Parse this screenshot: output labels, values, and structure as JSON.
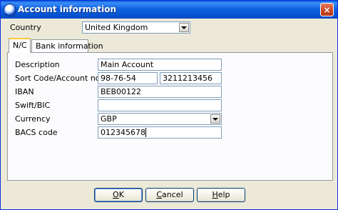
{
  "window": {
    "title": "Account information",
    "close_label": "×"
  },
  "country": {
    "label": "Country",
    "value": "United Kingdom"
  },
  "tabs": [
    {
      "label": "N/C",
      "active": true
    },
    {
      "label": "Bank information",
      "active": false
    }
  ],
  "form": {
    "description": {
      "label": "Description",
      "value": "Main Account"
    },
    "sort_account": {
      "label": "Sort Code/Account no",
      "sort_code": "98-76-54",
      "account_no": "3211213456"
    },
    "iban": {
      "label": "IBAN",
      "value": "BEB00122"
    },
    "swift": {
      "label": "Swift/BIC",
      "value": ""
    },
    "currency": {
      "label": "Currency",
      "value": "GBP"
    },
    "bacs": {
      "label": "BACS code",
      "value": "012345678"
    }
  },
  "buttons": {
    "ok": {
      "accel": "O",
      "rest": "K"
    },
    "cancel": {
      "accel": "C",
      "rest": "ancel"
    },
    "help": {
      "accel": "H",
      "rest": "elp"
    }
  },
  "colors": {
    "title_bar": "#0553d3",
    "dialog_bg": "#ece9d8",
    "active_tab_highlight": "#ffc83c"
  },
  "icons": {
    "app": "app-icon",
    "close": "close-icon",
    "combo": "chevron-down-icon"
  }
}
